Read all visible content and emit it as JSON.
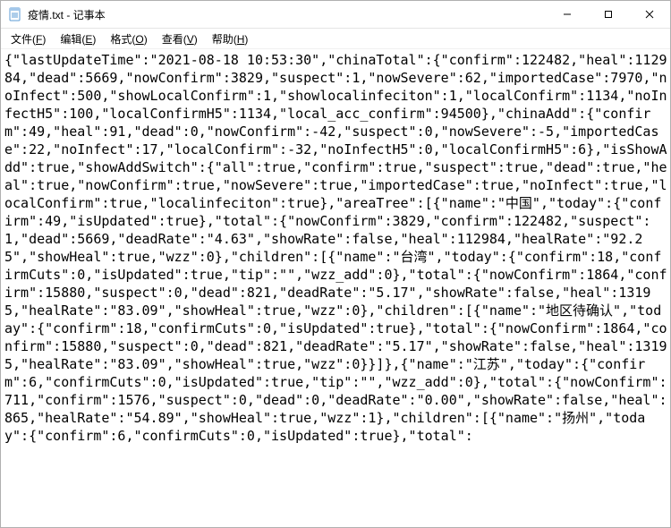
{
  "window": {
    "title": "疫情.txt - 记事本"
  },
  "menubar": {
    "file": "文件(F)",
    "edit": "编辑(E)",
    "format": "格式(O)",
    "view": "查看(V)",
    "help": "帮助(H)"
  },
  "content": "{\"lastUpdateTime\":\"2021-08-18 10:53:30\",\"chinaTotal\":{\"confirm\":122482,\"heal\":112984,\"dead\":5669,\"nowConfirm\":3829,\"suspect\":1,\"nowSevere\":62,\"importedCase\":7970,\"noInfect\":500,\"showLocalConfirm\":1,\"showlocalinfeciton\":1,\"localConfirm\":1134,\"noInfectH5\":100,\"localConfirmH5\":1134,\"local_acc_confirm\":94500},\"chinaAdd\":{\"confirm\":49,\"heal\":91,\"dead\":0,\"nowConfirm\":-42,\"suspect\":0,\"nowSevere\":-5,\"importedCase\":22,\"noInfect\":17,\"localConfirm\":-32,\"noInfectH5\":0,\"localConfirmH5\":6},\"isShowAdd\":true,\"showAddSwitch\":{\"all\":true,\"confirm\":true,\"suspect\":true,\"dead\":true,\"heal\":true,\"nowConfirm\":true,\"nowSevere\":true,\"importedCase\":true,\"noInfect\":true,\"localConfirm\":true,\"localinfeciton\":true},\"areaTree\":[{\"name\":\"中国\",\"today\":{\"confirm\":49,\"isUpdated\":true},\"total\":{\"nowConfirm\":3829,\"confirm\":122482,\"suspect\":1,\"dead\":5669,\"deadRate\":\"4.63\",\"showRate\":false,\"heal\":112984,\"healRate\":\"92.25\",\"showHeal\":true,\"wzz\":0},\"children\":[{\"name\":\"台湾\",\"today\":{\"confirm\":18,\"confirmCuts\":0,\"isUpdated\":true,\"tip\":\"\",\"wzz_add\":0},\"total\":{\"nowConfirm\":1864,\"confirm\":15880,\"suspect\":0,\"dead\":821,\"deadRate\":\"5.17\",\"showRate\":false,\"heal\":13195,\"healRate\":\"83.09\",\"showHeal\":true,\"wzz\":0},\"children\":[{\"name\":\"地区待确认\",\"today\":{\"confirm\":18,\"confirmCuts\":0,\"isUpdated\":true},\"total\":{\"nowConfirm\":1864,\"confirm\":15880,\"suspect\":0,\"dead\":821,\"deadRate\":\"5.17\",\"showRate\":false,\"heal\":13195,\"healRate\":\"83.09\",\"showHeal\":true,\"wzz\":0}}]},{\"name\":\"江苏\",\"today\":{\"confirm\":6,\"confirmCuts\":0,\"isUpdated\":true,\"tip\":\"\",\"wzz_add\":0},\"total\":{\"nowConfirm\":711,\"confirm\":1576,\"suspect\":0,\"dead\":0,\"deadRate\":\"0.00\",\"showRate\":false,\"heal\":865,\"healRate\":\"54.89\",\"showHeal\":true,\"wzz\":1},\"children\":[{\"name\":\"扬州\",\"today\":{\"confirm\":6,\"confirmCuts\":0,\"isUpdated\":true},\"total\":"
}
